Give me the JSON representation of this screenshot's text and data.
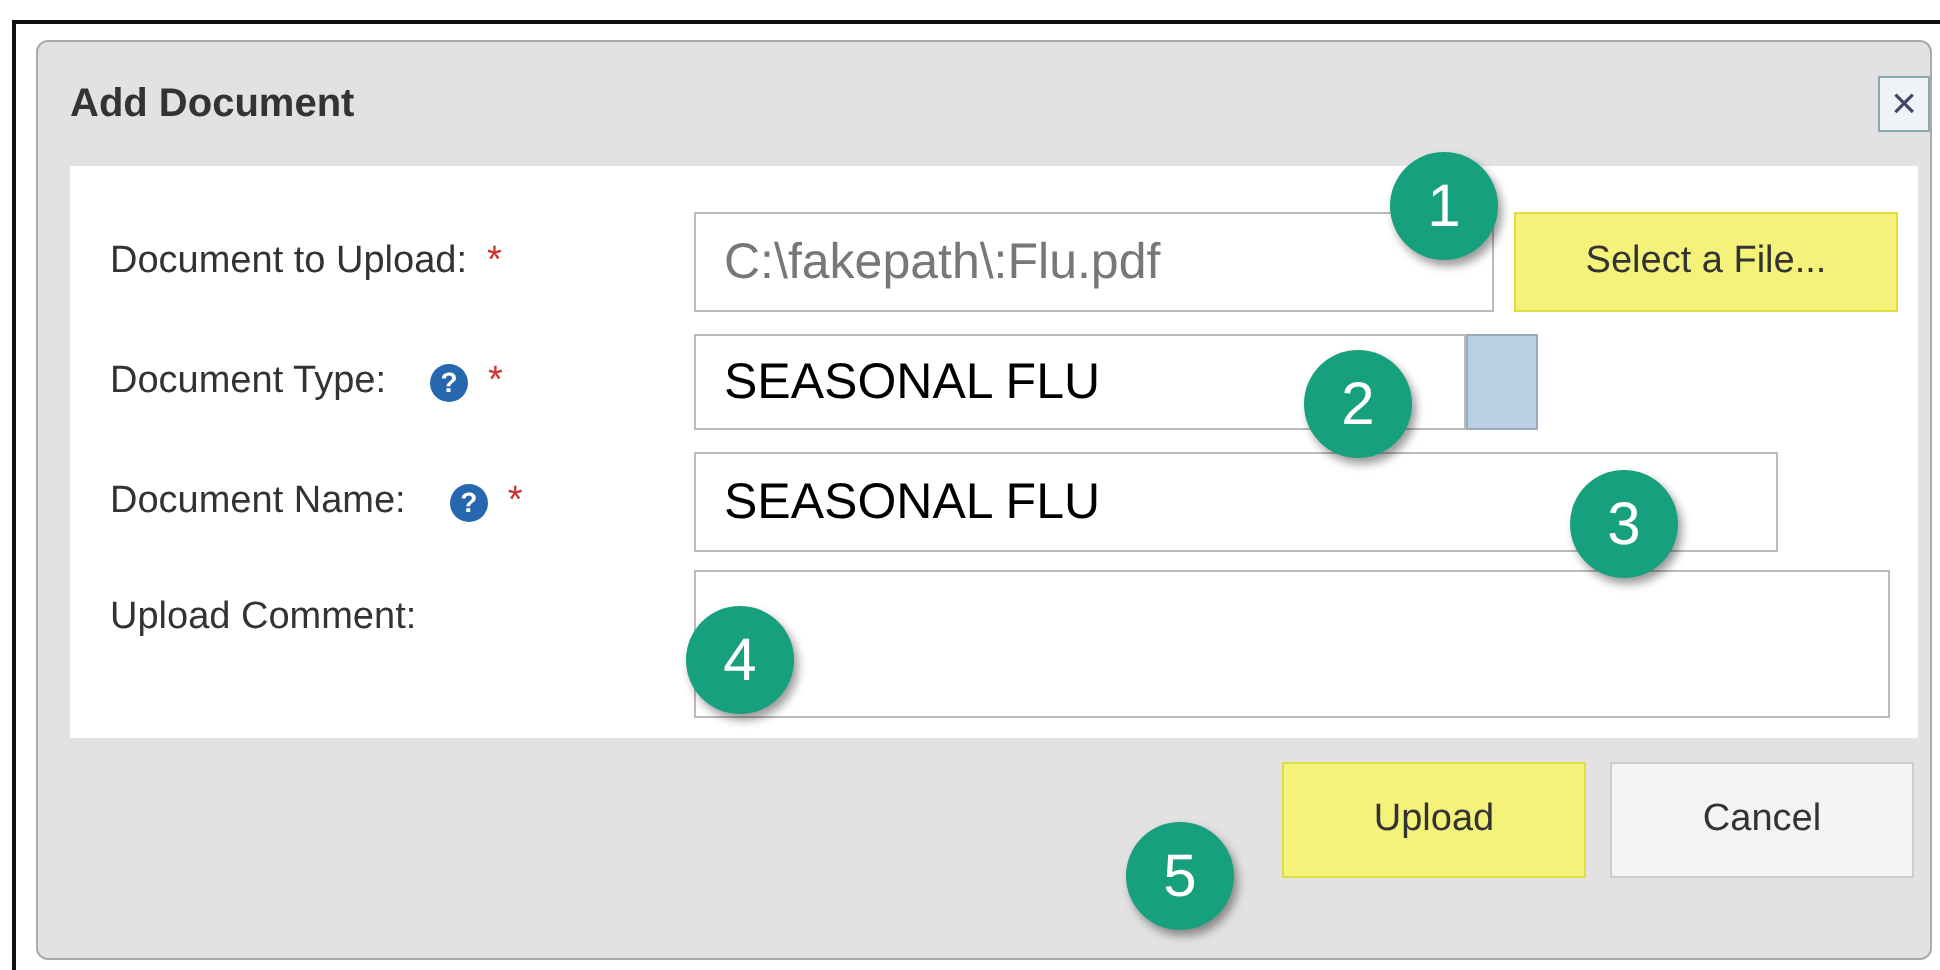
{
  "dialog": {
    "title": "Add Document",
    "close": "×"
  },
  "fields": [
    {
      "kind": "file",
      "label": "Document to Upload:",
      "required": "*",
      "value": "C:\\fakepath\\:Flu.pdf",
      "button": {
        "label": "Select a File...",
        "highlighted": true
      },
      "callout": "1"
    },
    {
      "kind": "select",
      "label": "Document Type:",
      "required": "*",
      "help": "?",
      "value": "SEASONAL FLU",
      "callout": "2"
    },
    {
      "kind": "text",
      "label": "Document Name:",
      "required": "*",
      "help": "?",
      "value": "SEASONAL FLU",
      "callout": "3"
    },
    {
      "kind": "textarea",
      "label": "Upload Comment:",
      "callout": "4"
    }
  ],
  "buttons": [
    {
      "label": "Upload",
      "highlighted": true,
      "callout": "5"
    },
    {
      "label": "Cancel",
      "highlighted": false
    }
  ]
}
